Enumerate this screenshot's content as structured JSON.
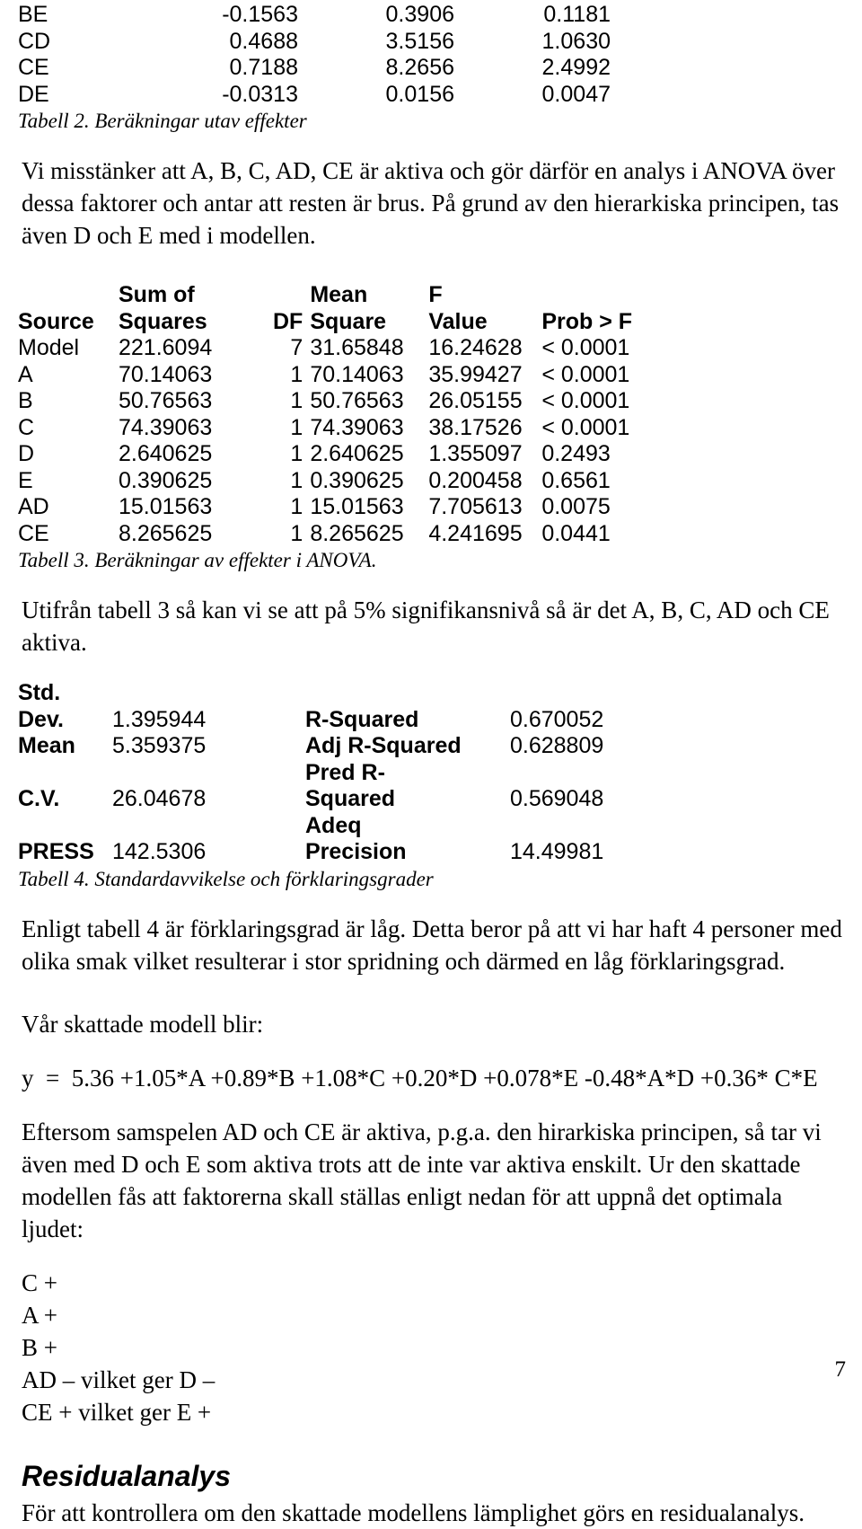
{
  "page": {
    "number": "7"
  },
  "table2": {
    "rows": [
      {
        "source": "BE",
        "effect": "-0.1563",
        "sum_sq": "0.3906",
        "contrib": "0.1181"
      },
      {
        "source": "CD",
        "effect": "0.4688",
        "sum_sq": "3.5156",
        "contrib": "1.0630"
      },
      {
        "source": "CE",
        "effect": "0.7188",
        "sum_sq": "8.2656",
        "contrib": "2.4992"
      },
      {
        "source": "DE",
        "effect": "-0.0313",
        "sum_sq": "0.0156",
        "contrib": "0.0047"
      }
    ],
    "caption": "Tabell 2. Beräkningar utav effekter"
  },
  "para1": "Vi misstänker att A, B, C, AD, CE är aktiva och gör därför en analys i ANOVA över dessa faktorer och antar att resten är brus. På grund av den hierarkiska principen, tas även D och E med i modellen.",
  "table3": {
    "header_line1": {
      "c0": "",
      "c1": "Sum of",
      "c2": "",
      "c3": "Mean",
      "c4": "F",
      "c5": ""
    },
    "header_line2": {
      "c0": "Source",
      "c1": "Squares",
      "c2": "DF",
      "c3": "Square",
      "c4": "Value",
      "c5": "Prob > F"
    },
    "rows": [
      {
        "source": "Model",
        "sum_squares": "221.6094",
        "df": "7",
        "mean_square": "31.65848",
        "f_value": "16.24628",
        "prob": "< 0.0001"
      },
      {
        "source": "A",
        "sum_squares": "70.14063",
        "df": "1",
        "mean_square": "70.14063",
        "f_value": "35.99427",
        "prob": "< 0.0001"
      },
      {
        "source": "B",
        "sum_squares": "50.76563",
        "df": "1",
        "mean_square": "50.76563",
        "f_value": "26.05155",
        "prob": "< 0.0001"
      },
      {
        "source": "C",
        "sum_squares": "74.39063",
        "df": "1",
        "mean_square": "74.39063",
        "f_value": "38.17526",
        "prob": "< 0.0001"
      },
      {
        "source": "D",
        "sum_squares": "2.640625",
        "df": "1",
        "mean_square": "2.640625",
        "f_value": "1.355097",
        "prob": "0.2493"
      },
      {
        "source": "E",
        "sum_squares": "0.390625",
        "df": "1",
        "mean_square": "0.390625",
        "f_value": "0.200458",
        "prob": "0.6561"
      },
      {
        "source": "AD",
        "sum_squares": "15.01563",
        "df": "1",
        "mean_square": "15.01563",
        "f_value": "7.705613",
        "prob": "0.0075"
      },
      {
        "source": "CE",
        "sum_squares": "8.265625",
        "df": "1",
        "mean_square": "8.265625",
        "f_value": "4.241695",
        "prob": "0.0441"
      }
    ],
    "caption": "Tabell 3. Beräkningar av effekter i ANOVA."
  },
  "para2": "Utifrån tabell 3 så kan vi se att på 5% signifikansnivå så är det A, B, C, AD och CE aktiva.",
  "table4": {
    "rows": [
      {
        "label_left": "Std.",
        "value_left": "",
        "label_right": "",
        "value_right": ""
      },
      {
        "label_left": "Dev.",
        "value_left": "1.395944",
        "label_right": "R-Squared",
        "value_right": "0.670052"
      },
      {
        "label_left": "Mean",
        "value_left": "5.359375",
        "label_right": "Adj R-Squared",
        "value_right": "0.628809"
      },
      {
        "label_left": "",
        "value_left": "",
        "label_right": "Pred R-",
        "value_right": ""
      },
      {
        "label_left": "C.V.",
        "value_left": "26.04678",
        "label_right": "Squared",
        "value_right": "0.569048"
      },
      {
        "label_left": "",
        "value_left": "",
        "label_right": "Adeq",
        "value_right": ""
      },
      {
        "label_left": "PRESS",
        "value_left": "142.5306",
        "label_right": "Precision",
        "value_right": "14.49981"
      }
    ],
    "caption": "Tabell 4. Standardavvikelse och förklaringsgrader"
  },
  "para3": "Enligt tabell 4 är förklaringsgrad är låg. Detta beror på att vi har haft 4 personer med olika smak vilket resulterar i stor spridning och därmed en låg förklaringsgrad.",
  "para4": "Vår skattade modell blir:",
  "equation": "y  =  5.36 +1.05*A +0.89*B +1.08*C +0.20*D +0.078*E -0.48*A*D +0.36* C*E",
  "para5": "Eftersom samspelen AD och CE är aktiva, p.g.a. den hirarkiska principen, så tar vi även med D och E som aktiva trots att de inte var aktiva enskilt. Ur den skattade modellen fås att faktorerna skall ställas enligt nedan för att uppnå det optimala ljudet:",
  "factor_settings": [
    "C +",
    "A +",
    "B +",
    "AD – vilket ger D –",
    "CE + vilket ger E +"
  ],
  "section": {
    "title": "Residualanalys",
    "text": "För att kontrollera om den skattade modellens lämplighet görs en residualanalys."
  }
}
